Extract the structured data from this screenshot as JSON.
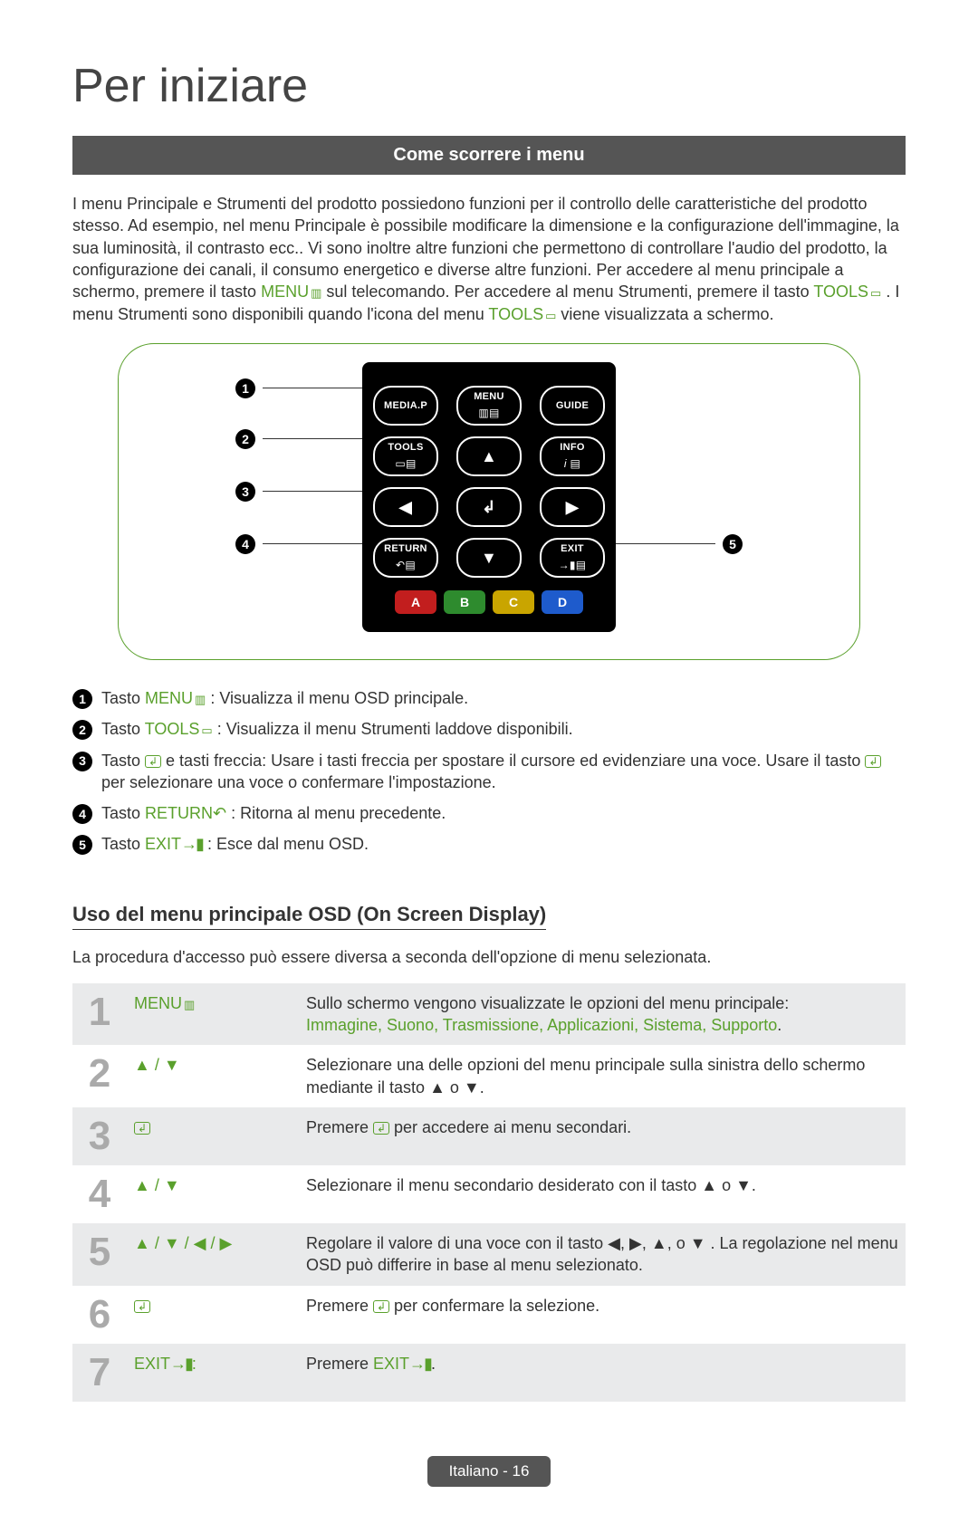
{
  "title": "Per iniziare",
  "section_bar": "Come scorrere i menu",
  "intro_parts": {
    "p1": "I menu Principale e Strumenti del prodotto possiedono funzioni per il controllo delle caratteristiche del prodotto stesso. Ad esempio, nel menu Principale è possibile modificare la dimensione e la configurazione dell'immagine, la sua luminosità, il contrasto ecc.. Vi sono inoltre altre funzioni che permettono di controllare l'audio del prodotto, la configurazione dei canali, il consumo energetico e diverse altre funzioni. Per accedere al menu principale a schermo, premere il tasto ",
    "kw_menu": "MENU",
    "p2": " sul telecomando. Per accedere al menu Strumenti, premere il tasto ",
    "kw_tools": "TOOLS",
    "p3": ". I menu Strumenti sono disponibili quando l'icona del menu ",
    "kw_tools2": "TOOLS",
    "p4": " viene visualizzata a schermo."
  },
  "remote": {
    "row1": {
      "left": "MEDIA.P",
      "mid": "MENU",
      "right": "GUIDE"
    },
    "row2": {
      "left": "TOOLS",
      "right": "INFO"
    },
    "row4": {
      "left": "RETURN",
      "right": "EXIT"
    },
    "abcd": [
      "A",
      "B",
      "C",
      "D"
    ]
  },
  "callouts": [
    "1",
    "2",
    "3",
    "4",
    "5"
  ],
  "legend": {
    "l1": {
      "pre": "Tasto ",
      "kw": "MENU",
      "post": ": Visualizza il menu OSD principale."
    },
    "l2": {
      "pre": "Tasto ",
      "kw": "TOOLS",
      "post": ": Visualizza il menu Strumenti laddove disponibili."
    },
    "l3": {
      "pre": "Tasto ",
      "mid": " e tasti freccia: Usare i tasti freccia per spostare il cursore ed evidenziare una voce. Usare il tasto ",
      "post": " per selezionare una voce o confermare l'impostazione."
    },
    "l4": {
      "pre": "Tasto ",
      "kw": "RETURN",
      "post": ": Ritorna al menu precedente."
    },
    "l5": {
      "pre": "Tasto ",
      "kw": "EXIT",
      "post": ": Esce dal menu OSD."
    }
  },
  "sub_heading": "Uso del menu principale OSD (On Screen Display)",
  "sub_intro": "La procedura d'accesso può essere diversa a seconda dell'opzione di menu selezionata.",
  "steps": [
    {
      "num": "1",
      "key_html": "MENU",
      "key_icon": "menu",
      "desc_line1": "Sullo schermo vengono visualizzate le opzioni del menu principale:",
      "desc_kw": "Immagine, Suono, Trasmissione, Applicazioni, Sistema, Supporto",
      "desc_tail": "."
    },
    {
      "num": "2",
      "key_glyphs": "▲ / ▼",
      "desc": "Selezionare una delle opzioni del menu principale sulla sinistra dello schermo mediante il tasto ▲ o ▼."
    },
    {
      "num": "3",
      "key_icon_only": "enter",
      "desc_pre": "Premere ",
      "desc_post": " per accedere ai menu secondari."
    },
    {
      "num": "4",
      "key_glyphs": "▲ / ▼",
      "desc": "Selezionare il menu secondario desiderato con il tasto ▲ o ▼."
    },
    {
      "num": "5",
      "key_glyphs": "▲ / ▼ / ◀ / ▶",
      "desc": "Regolare il valore di una voce con il tasto ◀, ▶, ▲, o ▼ . La regolazione nel menu OSD può differire in base al menu selezionato."
    },
    {
      "num": "6",
      "key_icon_only": "enter",
      "desc_pre": "Premere ",
      "desc_post": " per confermare la selezione."
    },
    {
      "num": "7",
      "key_html": "EXIT",
      "key_icon": "exit",
      "key_suffix": ":",
      "desc_pre": "Premere ",
      "desc_kw": "EXIT",
      "desc_icon": "exit",
      "desc_post": "."
    }
  ],
  "footer": "Italiano - 16"
}
